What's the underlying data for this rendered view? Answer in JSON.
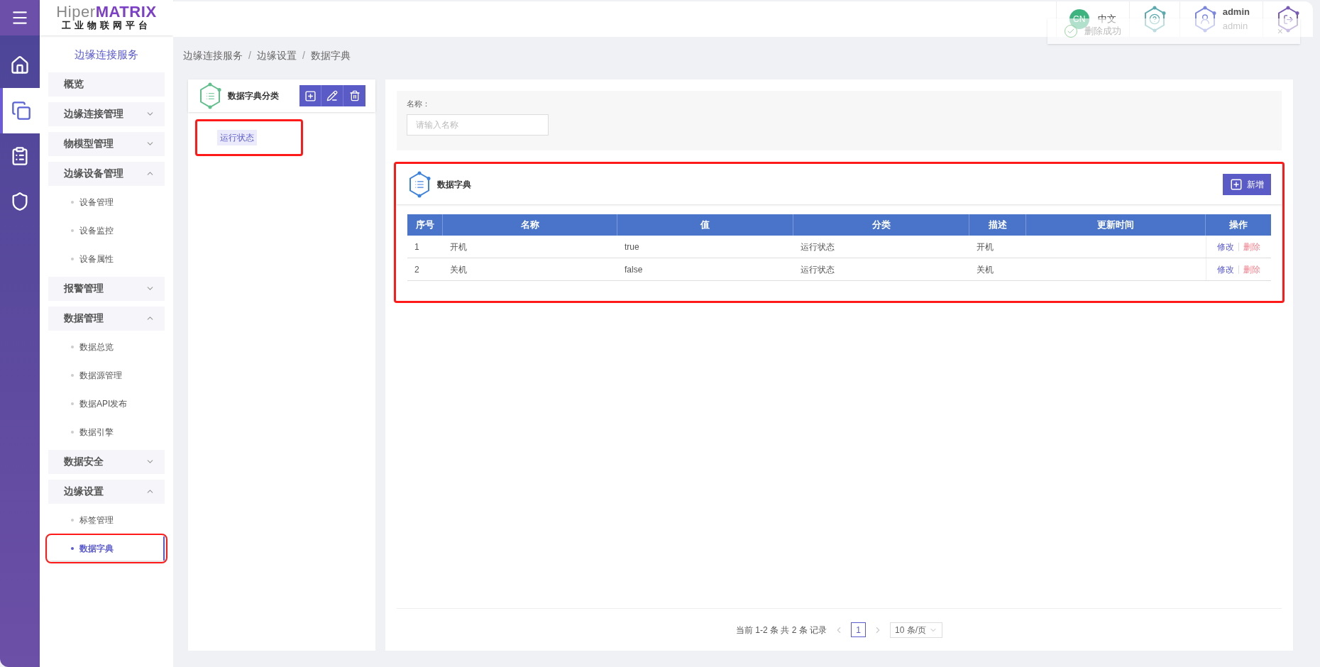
{
  "logo": {
    "brand_light": "Hiper",
    "brand_strong": "MATRIX",
    "subtitle": "工业物联网平台"
  },
  "rail": [
    {
      "selected": false
    },
    {
      "selected": true
    },
    {
      "selected": false
    },
    {
      "selected": false
    }
  ],
  "header": {
    "lang_badge": "CN",
    "lang": "中文",
    "user_name": "admin",
    "user_role": "admin"
  },
  "toast": {
    "kind": "success",
    "text": "删除成功",
    "close": "×"
  },
  "sidebar": {
    "title": "边缘连接服务",
    "groups": [
      {
        "label": "概览"
      },
      {
        "label": "边缘连接管理",
        "expanded": false
      },
      {
        "label": "物模型管理",
        "expanded": false
      },
      {
        "label": "边缘设备管理",
        "expanded": true,
        "children": [
          {
            "label": "设备管理",
            "selected": false,
            "highlighted": false
          },
          {
            "label": "设备监控",
            "selected": false,
            "highlighted": false
          },
          {
            "label": "设备属性",
            "selected": false,
            "highlighted": false
          }
        ]
      },
      {
        "label": "报警管理",
        "expanded": false
      },
      {
        "label": "数据管理",
        "expanded": true,
        "children": [
          {
            "label": "数据总览",
            "selected": false,
            "highlighted": false
          },
          {
            "label": "数据源管理",
            "selected": false,
            "highlighted": false
          },
          {
            "label": "数据API发布",
            "selected": false,
            "highlighted": false
          },
          {
            "label": "数据引擎",
            "selected": false,
            "highlighted": false
          }
        ]
      },
      {
        "label": "数据安全",
        "expanded": false
      },
      {
        "label": "边缘设置",
        "expanded": true,
        "children": [
          {
            "label": "标签管理",
            "selected": false,
            "highlighted": false
          },
          {
            "label": "数据字典",
            "selected": true,
            "highlighted": true
          }
        ]
      }
    ]
  },
  "breadcrumb": [
    "边缘连接服务",
    "边缘设置",
    "数据字典"
  ],
  "breadcrumb_separator": "/",
  "categories_panel": {
    "title": "数据字典分类",
    "items": [
      {
        "label": "运行状态",
        "selected": true,
        "highlighted": true
      }
    ]
  },
  "search": {
    "label": "名称：",
    "placeholder": "请输入名称"
  },
  "dictionary": {
    "title": "数据字典",
    "add_button": "新增",
    "highlighted": true,
    "columns": [
      "序号",
      "名称",
      "值",
      "分类",
      "描述",
      "更新时间",
      "操作"
    ],
    "rows": [
      {
        "index": "1",
        "name": "开机",
        "value": "true",
        "category": "运行状态",
        "description": "开机",
        "edit": "修改",
        "delete": "删除"
      },
      {
        "index": "2",
        "name": "关机",
        "value": "false",
        "category": "运行状态",
        "description": "关机",
        "edit": "修改",
        "delete": "删除"
      }
    ]
  },
  "pagination": {
    "summary": "当前 1-2 条 共 2 条 记录",
    "pages": [
      {
        "label": "1",
        "selected": true
      }
    ],
    "page_size": "10 条/页"
  }
}
